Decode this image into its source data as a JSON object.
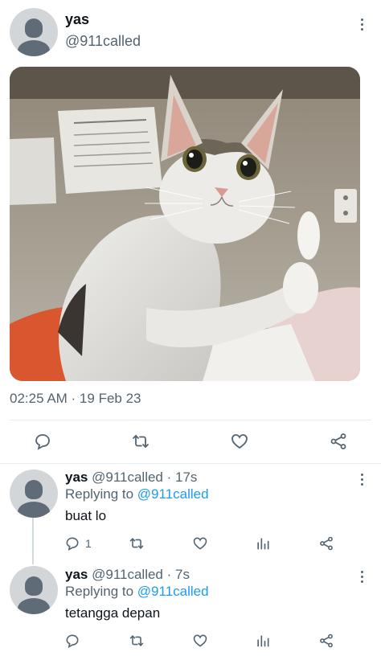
{
  "main_tweet": {
    "name": "yas",
    "handle": "@911called",
    "timestamp": "02:25 AM · 19 Feb 23"
  },
  "replies": [
    {
      "name": "yas",
      "meta": "@911called · 17s",
      "replying_prefix": "Replying to",
      "replying_to": "@911called",
      "text": "buat lo",
      "reply_count": "1"
    },
    {
      "name": "yas",
      "meta": "@911called · 7s",
      "replying_prefix": "Replying to",
      "replying_to": "@911called",
      "text": "tetangga depan",
      "reply_count": ""
    }
  ],
  "icons": {
    "reply": "comment-icon",
    "retweet": "retweet-icon",
    "like": "heart-icon",
    "analytics": "analytics-icon",
    "share": "share-icon",
    "more": "more-vertical-icon"
  },
  "colors": {
    "text_primary": "#0f1419",
    "text_secondary": "#536471",
    "link": "#1d9bf0",
    "divider": "#e6ecf0"
  }
}
